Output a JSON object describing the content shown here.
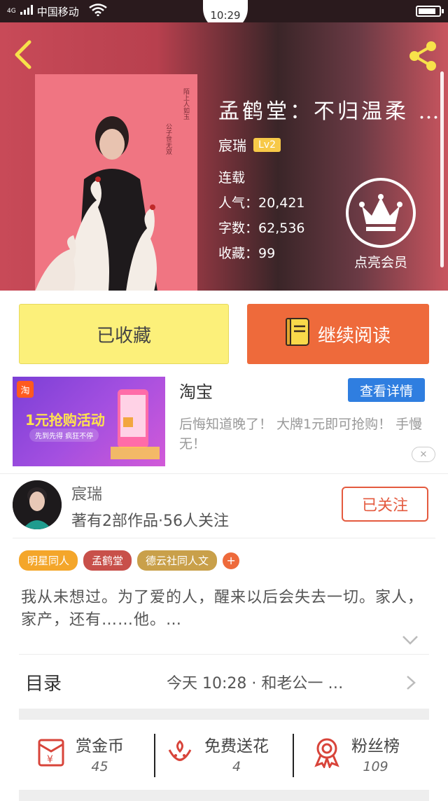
{
  "status_bar": {
    "network": "4G",
    "carrier": "中国移动",
    "time": "10:29"
  },
  "book": {
    "title": "孟鹤堂：不归温柔 …",
    "author": "宸瑞",
    "author_level": "Lv2",
    "status": "连载",
    "popularity_label": "人气：",
    "popularity": "20,421",
    "word_count_label": "字数：",
    "word_count": "62,536",
    "favorites_label": "收藏：",
    "favorites": "99"
  },
  "vip": {
    "label": "点亮会员"
  },
  "actions": {
    "collected_label": "已收藏",
    "continue_label": "继续阅读"
  },
  "ad": {
    "logo_text": "淘",
    "image_headline": "1元抢购活动",
    "image_subline": "先到先得 疯狂不停",
    "title": "淘宝",
    "details_label": "查看详情",
    "description": "后悔知道晚了！ 大牌1元即可抢购！ 手慢无！"
  },
  "author_card": {
    "name": "宸瑞",
    "info": "著有2部作品·56人关注",
    "follow_label": "已关注"
  },
  "tags": [
    {
      "label": "明星同人",
      "color": "#f4a62a"
    },
    {
      "label": "孟鹤堂",
      "color": "#c8504a"
    },
    {
      "label": "德云社同人文",
      "color": "#c9a04a"
    }
  ],
  "tag_add_label": "+",
  "synopsis": "我从未想过。为了爱的人，醒来以后会失去一切。家人，家产，还有……他。…",
  "toc": {
    "label": "目录",
    "latest": "今天 10:28 · 和老公一 …"
  },
  "stats": [
    {
      "label": "赏金币",
      "value": "45"
    },
    {
      "label": "免费送花",
      "value": "4"
    },
    {
      "label": "粉丝榜",
      "value": "109"
    }
  ],
  "colors": {
    "accent_orange": "#ee6a3b",
    "collected_yellow": "#fcf07a",
    "link_blue": "#2f7ee0",
    "icon_red": "#d8443a"
  }
}
